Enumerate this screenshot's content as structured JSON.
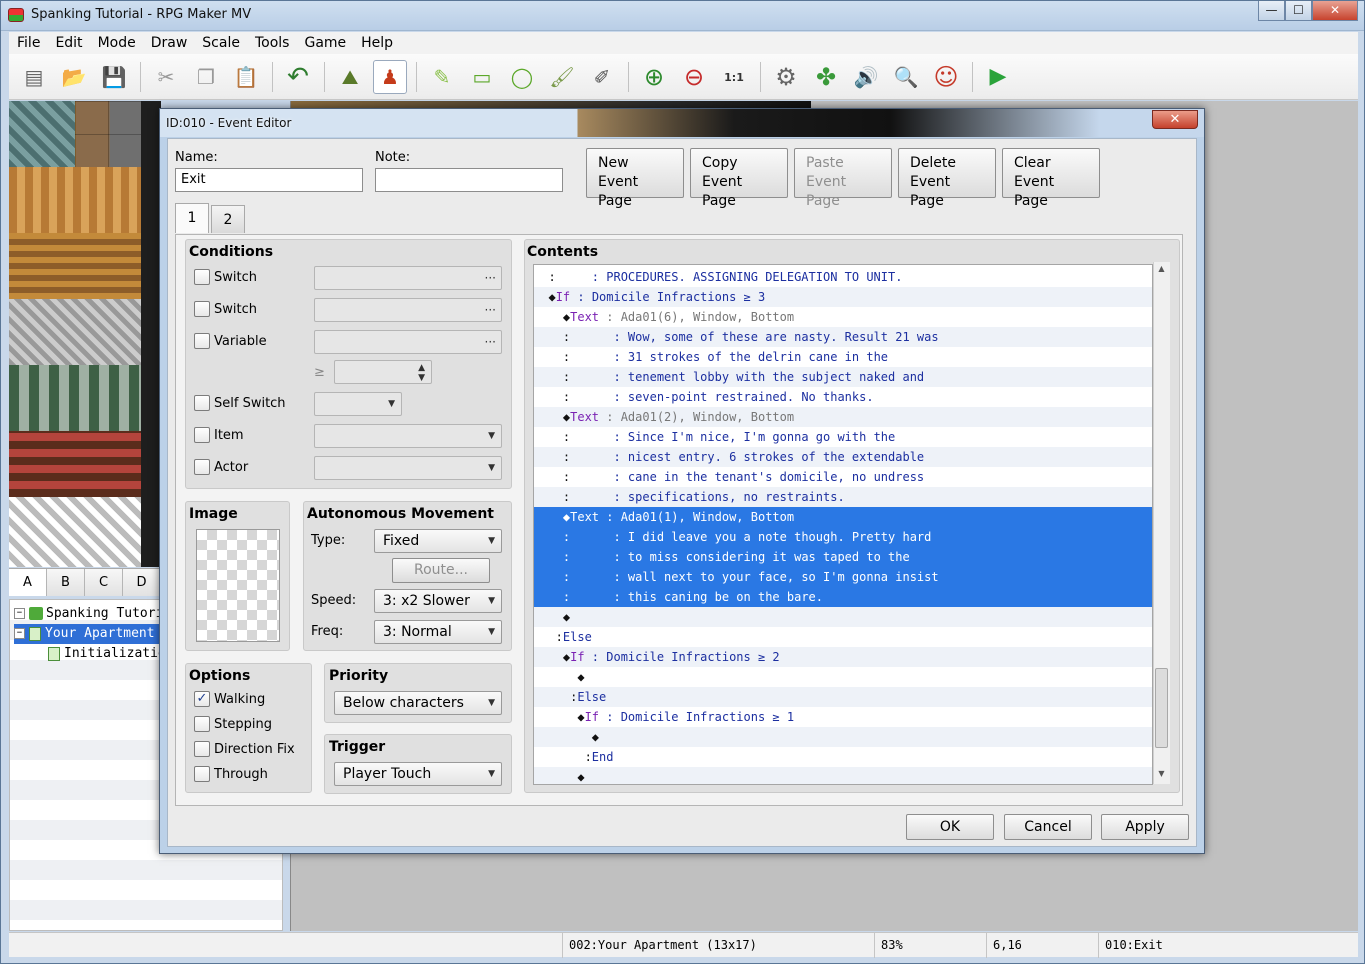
{
  "app": {
    "title": "Spanking Tutorial - RPG Maker MV",
    "min_glyph": "—",
    "max_glyph": "☐",
    "close_glyph": "✕"
  },
  "menu": [
    "File",
    "Edit",
    "Mode",
    "Draw",
    "Scale",
    "Tools",
    "Game",
    "Help"
  ],
  "toolbar": [
    {
      "icon": "new-project-icon",
      "glyph": "▤"
    },
    {
      "icon": "open-project-icon",
      "glyph": "📂"
    },
    {
      "icon": "save-project-icon",
      "glyph": "💾"
    },
    {
      "icon": "cut-icon",
      "glyph": "✂"
    },
    {
      "icon": "copy-icon",
      "glyph": "❐"
    },
    {
      "icon": "paste-icon",
      "glyph": "📋"
    },
    {
      "icon": "undo-icon",
      "glyph": "↶"
    },
    {
      "icon": "map-mode-icon",
      "glyph": "⛰"
    },
    {
      "icon": "event-mode-icon",
      "glyph": "♟"
    },
    {
      "icon": "pencil-icon",
      "glyph": "✎"
    },
    {
      "icon": "rectangle-icon",
      "glyph": "▭"
    },
    {
      "icon": "ellipse-icon",
      "glyph": "◯"
    },
    {
      "icon": "flood-fill-icon",
      "glyph": "🖌"
    },
    {
      "icon": "shadow-pen-icon",
      "glyph": "✐"
    },
    {
      "icon": "zoom-in-icon",
      "glyph": "⊕"
    },
    {
      "icon": "zoom-out-icon",
      "glyph": "⊖"
    },
    {
      "icon": "zoom-actual-icon",
      "glyph": "1:1"
    },
    {
      "icon": "database-icon",
      "glyph": "⚙"
    },
    {
      "icon": "plugin-manager-icon",
      "glyph": "✤"
    },
    {
      "icon": "sound-test-icon",
      "glyph": "🔊"
    },
    {
      "icon": "event-searcher-icon",
      "glyph": "🔍"
    },
    {
      "icon": "character-generator-icon",
      "glyph": "☺"
    },
    {
      "icon": "playtest-icon",
      "glyph": "▶"
    }
  ],
  "tileset_tabs": [
    "A",
    "B",
    "C",
    "D"
  ],
  "map_tree": {
    "project": "Spanking Tutorial",
    "map": "Your Apartment",
    "child": "Initialization",
    "collapse_glyph": "−"
  },
  "statusbar": {
    "map": "002:Your Apartment (13x17)",
    "zoom": "83%",
    "coords": "6,16",
    "event": "010:Exit"
  },
  "dialog": {
    "title": "ID:010 - Event Editor",
    "close_glyph": "✕",
    "name_label": "Name:",
    "name_value": "Exit",
    "note_label": "Note:",
    "note_value": "",
    "buttons": {
      "new_page": [
        "New",
        "Event Page"
      ],
      "copy_page": [
        "Copy",
        "Event Page"
      ],
      "paste_page": [
        "Paste",
        "Event Page"
      ],
      "delete_page": [
        "Delete",
        "Event Page"
      ],
      "clear_page": [
        "Clear",
        "Event Page"
      ]
    },
    "page_tabs": [
      "1",
      "2"
    ],
    "conditions": {
      "title": "Conditions",
      "items": [
        "Switch",
        "Switch",
        "Variable",
        "Self Switch",
        "Item",
        "Actor"
      ],
      "ge_symbol": "≥",
      "dots": "···"
    },
    "image": {
      "title": "Image"
    },
    "autonomous": {
      "title": "Autonomous Movement",
      "type_label": "Type:",
      "type_value": "Fixed",
      "route_label": "Route...",
      "speed_label": "Speed:",
      "speed_value": "3: x2 Slower",
      "freq_label": "Freq:",
      "freq_value": "3: Normal"
    },
    "options": {
      "title": "Options",
      "items": [
        {
          "label": "Walking",
          "checked": true
        },
        {
          "label": "Stepping",
          "checked": false
        },
        {
          "label": "Direction Fix",
          "checked": false
        },
        {
          "label": "Through",
          "checked": false
        }
      ],
      "check_glyph": "✓"
    },
    "priority": {
      "title": "Priority",
      "value": "Below characters"
    },
    "trigger": {
      "title": "Trigger",
      "value": "Player Touch"
    },
    "contents_title": "Contents",
    "event_lines": [
      {
        "prefix": "  :     ",
        "cmd": "",
        "arg": ": PROCEDURES. ASSIGNING DELEGATION TO UNIT.",
        "kind": "txt",
        "sel": false
      },
      {
        "prefix": "  ◆",
        "cmd": "If",
        "arg": " : Domicile Infractions ≥ 3",
        "kind": "txt",
        "sel": false
      },
      {
        "prefix": "    ◆",
        "cmd": "Text",
        "arg": " : Ada01(6), Window, Bottom",
        "kind": "grey",
        "sel": false
      },
      {
        "prefix": "    :      ",
        "cmd": "",
        "arg": ": Wow, some of these are nasty. Result 21 was",
        "kind": "txt",
        "sel": false
      },
      {
        "prefix": "    :      ",
        "cmd": "",
        "arg": ": 31 strokes of the delrin cane in the",
        "kind": "txt",
        "sel": false
      },
      {
        "prefix": "    :      ",
        "cmd": "",
        "arg": ": tenement lobby with the subject naked and",
        "kind": "txt",
        "sel": false
      },
      {
        "prefix": "    :      ",
        "cmd": "",
        "arg": ": seven-point restrained. No thanks.",
        "kind": "txt",
        "sel": false
      },
      {
        "prefix": "    ◆",
        "cmd": "Text",
        "arg": " : Ada01(2), Window, Bottom",
        "kind": "grey",
        "sel": false
      },
      {
        "prefix": "    :      ",
        "cmd": "",
        "arg": ": Since I'm nice, I'm gonna go with the",
        "kind": "txt",
        "sel": false
      },
      {
        "prefix": "    :      ",
        "cmd": "",
        "arg": ": nicest entry. 6 strokes of the extendable",
        "kind": "txt",
        "sel": false
      },
      {
        "prefix": "    :      ",
        "cmd": "",
        "arg": ": cane in the tenant's domicile, no undress",
        "kind": "txt",
        "sel": false
      },
      {
        "prefix": "    :      ",
        "cmd": "",
        "arg": ": specifications, no restraints.",
        "kind": "txt",
        "sel": false
      },
      {
        "prefix": "    ◆",
        "cmd": "Text",
        "arg": " : Ada01(1), Window, Bottom",
        "kind": "grey",
        "sel": true
      },
      {
        "prefix": "    :      ",
        "cmd": "",
        "arg": ": I did leave you a note though. Pretty hard",
        "kind": "txt",
        "sel": true
      },
      {
        "prefix": "    :      ",
        "cmd": "",
        "arg": ": to miss considering it was taped to the",
        "kind": "txt",
        "sel": true
      },
      {
        "prefix": "    :      ",
        "cmd": "",
        "arg": ": wall next to your face, so I'm gonna insist",
        "kind": "txt",
        "sel": true
      },
      {
        "prefix": "    :      ",
        "cmd": "",
        "arg": ": this caning be on the bare.",
        "kind": "txt",
        "sel": true
      },
      {
        "prefix": "    ◆",
        "cmd": "",
        "arg": "",
        "kind": "txt",
        "sel": false
      },
      {
        "prefix": "   :",
        "cmd": "Else",
        "arg": "",
        "kind": "txt",
        "sel": false
      },
      {
        "prefix": "    ◆",
        "cmd": "If",
        "arg": " : Domicile Infractions ≥ 2",
        "kind": "txt",
        "sel": false
      },
      {
        "prefix": "      ◆",
        "cmd": "",
        "arg": "",
        "kind": "txt",
        "sel": false
      },
      {
        "prefix": "     :",
        "cmd": "Else",
        "arg": "",
        "kind": "txt",
        "sel": false
      },
      {
        "prefix": "      ◆",
        "cmd": "If",
        "arg": " : Domicile Infractions ≥ 1",
        "kind": "txt",
        "sel": false
      },
      {
        "prefix": "        ◆",
        "cmd": "",
        "arg": "",
        "kind": "txt",
        "sel": false
      },
      {
        "prefix": "       :",
        "cmd": "End",
        "arg": "",
        "kind": "txt",
        "sel": false
      },
      {
        "prefix": "      ◆",
        "cmd": "",
        "arg": "",
        "kind": "txt",
        "sel": false
      }
    ],
    "footer": {
      "ok": "OK",
      "cancel": "Cancel",
      "apply": "Apply"
    }
  }
}
